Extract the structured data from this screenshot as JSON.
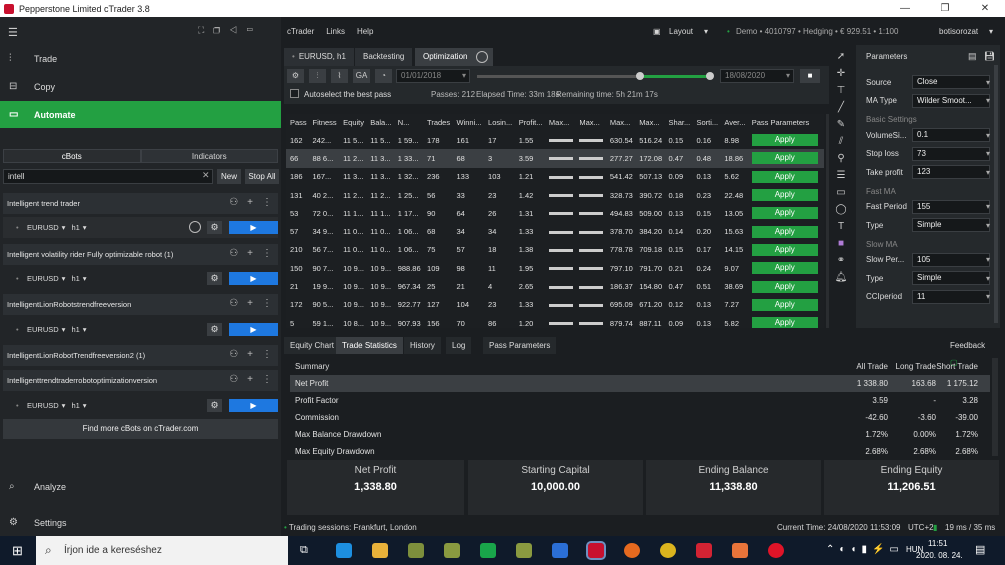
{
  "window": {
    "title": "Pepperstone Limited cTrader 3.8"
  },
  "sidebar": {
    "nav": [
      {
        "label": "Trade"
      },
      {
        "label": "Copy"
      },
      {
        "label": "Automate"
      }
    ],
    "bottom_nav": [
      {
        "label": "Analyze"
      },
      {
        "label": "Settings"
      }
    ],
    "tabs": [
      {
        "label": "cBots"
      },
      {
        "label": "Indicators"
      }
    ],
    "search_value": "intell",
    "new_label": "New",
    "stop_all_label": "Stop All",
    "bots": [
      {
        "name": "Intelligent trend trader",
        "symbol": "EURUSD",
        "timeframe": "h1"
      },
      {
        "name": "Intelligent volatility rider Fully optimizable robot (1)",
        "symbol": "EURUSD",
        "timeframe": "h1"
      },
      {
        "name": "IntelligentLionRobotstrendfreeversion",
        "symbol": "EURUSD",
        "timeframe": "h1"
      },
      {
        "name": "IntelligentLionRobotTrendfreeversion2 (1)",
        "symbol": "EURUSD",
        "timeframe": "h1"
      },
      {
        "name": "Intelligenttrendtraderrobotoptimizationversion",
        "symbol": "EURUSD",
        "timeframe": "h1"
      }
    ],
    "find_more": "Find more cBots on cTrader.com"
  },
  "menu": {
    "items": [
      "cTrader",
      "Links",
      "Help"
    ],
    "layout": "Layout",
    "account": "Demo • 4010797 • Hedging • € 929.51 • 1:100",
    "user": "botisorozat"
  },
  "main": {
    "tabs": [
      {
        "label": "EURUSD, h1"
      },
      {
        "label": "Backtesting"
      },
      {
        "label": "Optimization"
      }
    ],
    "toolbar_icons": [
      "gear-icon",
      "sliders-icon",
      "chart-icon"
    ],
    "ga_label": "GA",
    "date_from": "01/01/2018",
    "date_to": "18/08/2020",
    "autoselect": "Autoselect the best pass",
    "passes": "Passes: 212",
    "elapsed": "Elapsed Time: 33m 18s",
    "remaining": "Remaining time: 5h 21m 17s",
    "table": {
      "headers": [
        "Pass",
        "Fitness",
        "Equity",
        "Bala...",
        "N...",
        "Trades",
        "Winni...",
        "Losin...",
        "Profit...",
        "Max...",
        "Max...",
        "Max...",
        "Max...",
        "Shar...",
        "Sorti...",
        "Aver...",
        "Pass Parameters"
      ],
      "apply_label": "Apply",
      "rows": [
        [
          "162",
          "242...",
          "11 5...",
          "11 5...",
          "1 59...",
          "178",
          "161",
          "17",
          "1.55",
          "",
          "",
          "630.54",
          "516.24",
          "0.15",
          "0.16",
          "8.98"
        ],
        [
          "66",
          "88 6...",
          "11 2...",
          "11 3...",
          "1 33...",
          "71",
          "68",
          "3",
          "3.59",
          "",
          "",
          "277.27",
          "172.08",
          "0.47",
          "0.48",
          "18.86"
        ],
        [
          "186",
          "167...",
          "11 3...",
          "11 3...",
          "1 32...",
          "236",
          "133",
          "103",
          "1.21",
          "",
          "",
          "541.42",
          "507.13",
          "0.09",
          "0.13",
          "5.62"
        ],
        [
          "131",
          "40 2...",
          "11 2...",
          "11 2...",
          "1 25...",
          "56",
          "33",
          "23",
          "1.42",
          "",
          "",
          "328.73",
          "390.72",
          "0.18",
          "0.23",
          "22.48"
        ],
        [
          "53",
          "72 0...",
          "11 1...",
          "11 1...",
          "1 17...",
          "90",
          "64",
          "26",
          "1.31",
          "",
          "",
          "494.83",
          "509.00",
          "0.13",
          "0.15",
          "13.05"
        ],
        [
          "57",
          "34 9...",
          "11 0...",
          "11 0...",
          "1 06...",
          "68",
          "34",
          "34",
          "1.33",
          "",
          "",
          "378.70",
          "384.20",
          "0.14",
          "0.20",
          "15.63"
        ],
        [
          "210",
          "56 7...",
          "11 0...",
          "11 0...",
          "1 06...",
          "75",
          "57",
          "18",
          "1.38",
          "",
          "",
          "778.78",
          "709.18",
          "0.15",
          "0.17",
          "14.15"
        ],
        [
          "150",
          "90 7...",
          "10 9...",
          "10 9...",
          "988.86",
          "109",
          "98",
          "11",
          "1.95",
          "",
          "",
          "797.10",
          "791.70",
          "0.21",
          "0.24",
          "9.07"
        ],
        [
          "21",
          "19 9...",
          "10 9...",
          "10 9...",
          "967.34",
          "25",
          "21",
          "4",
          "2.65",
          "",
          "",
          "186.37",
          "154.80",
          "0.47",
          "0.51",
          "38.69"
        ],
        [
          "172",
          "90 5...",
          "10 9...",
          "10 9...",
          "922.77",
          "127",
          "104",
          "23",
          "1.33",
          "",
          "",
          "695.09",
          "671.20",
          "0.12",
          "0.13",
          "7.27"
        ],
        [
          "5",
          "59 1...",
          "10 8...",
          "10 9...",
          "907.93",
          "156",
          "70",
          "86",
          "1.20",
          "",
          "",
          "879.74",
          "887.11",
          "0.09",
          "0.13",
          "5.82"
        ]
      ]
    }
  },
  "params": {
    "title": "Parameters",
    "rows": [
      {
        "label": "Source",
        "value": "Close"
      },
      {
        "label": "MA Type",
        "value": "Wilder Smoot..."
      },
      {
        "section": "Basic Settings"
      },
      {
        "label": "VolumeSi...",
        "value": "0.1"
      },
      {
        "label": "Stop loss",
        "value": "73"
      },
      {
        "label": "Take profit",
        "value": "123"
      },
      {
        "section": "Fast MA"
      },
      {
        "label": "Fast Period",
        "value": "155"
      },
      {
        "label": "Type",
        "value": "Simple"
      },
      {
        "section": "Slow MA"
      },
      {
        "label": "Slow Per...",
        "value": "105"
      },
      {
        "label": "Type",
        "value": "Simple"
      },
      {
        "label": "CCIperiod",
        "value": "11"
      }
    ],
    "feedback": "Feedback"
  },
  "bottom": {
    "tabs": [
      {
        "label": "Equity Chart"
      },
      {
        "label": "Trade Statistics"
      },
      {
        "label": "History"
      },
      {
        "label": "Log"
      },
      {
        "label": "Pass Parameters"
      }
    ],
    "stats_header": {
      "label": "Summary",
      "all": "All Trade",
      "long": "Long Trade",
      "short": "Short Trade"
    },
    "stats": [
      {
        "label": "Net Profit",
        "all": "1 338.80",
        "long": "163.68",
        "short": "1 175.12"
      },
      {
        "label": "Profit Factor",
        "all": "3.59",
        "long": "-",
        "short": "3.28"
      },
      {
        "label": "Commission",
        "all": "-42.60",
        "long": "-3.60",
        "short": "-39.00"
      },
      {
        "label": "Max Balance Drawdown",
        "all": "1.72%",
        "long": "0.00%",
        "short": "1.72%"
      },
      {
        "label": "Max Equity Drawdown",
        "all": "2.68%",
        "long": "2.68%",
        "short": "2.68%"
      }
    ],
    "cards": [
      {
        "title": "Net Profit",
        "value": "1,338.80"
      },
      {
        "title": "Starting Capital",
        "value": "10,000.00"
      },
      {
        "title": "Ending Balance",
        "value": "11,338.80"
      },
      {
        "title": "Ending Equity",
        "value": "11,206.51"
      }
    ]
  },
  "status": {
    "sessions": "Trading sessions: Frankfurt, London",
    "time": "Current Time: 24/08/2020 11:53:09",
    "tz": "UTC+2",
    "latency": "19 ms / 35 ms"
  },
  "taskbar": {
    "search": "Írjon ide a kereséshez",
    "clock": "11:51",
    "date": "2020. 08. 24.",
    "lang": "HUN"
  }
}
